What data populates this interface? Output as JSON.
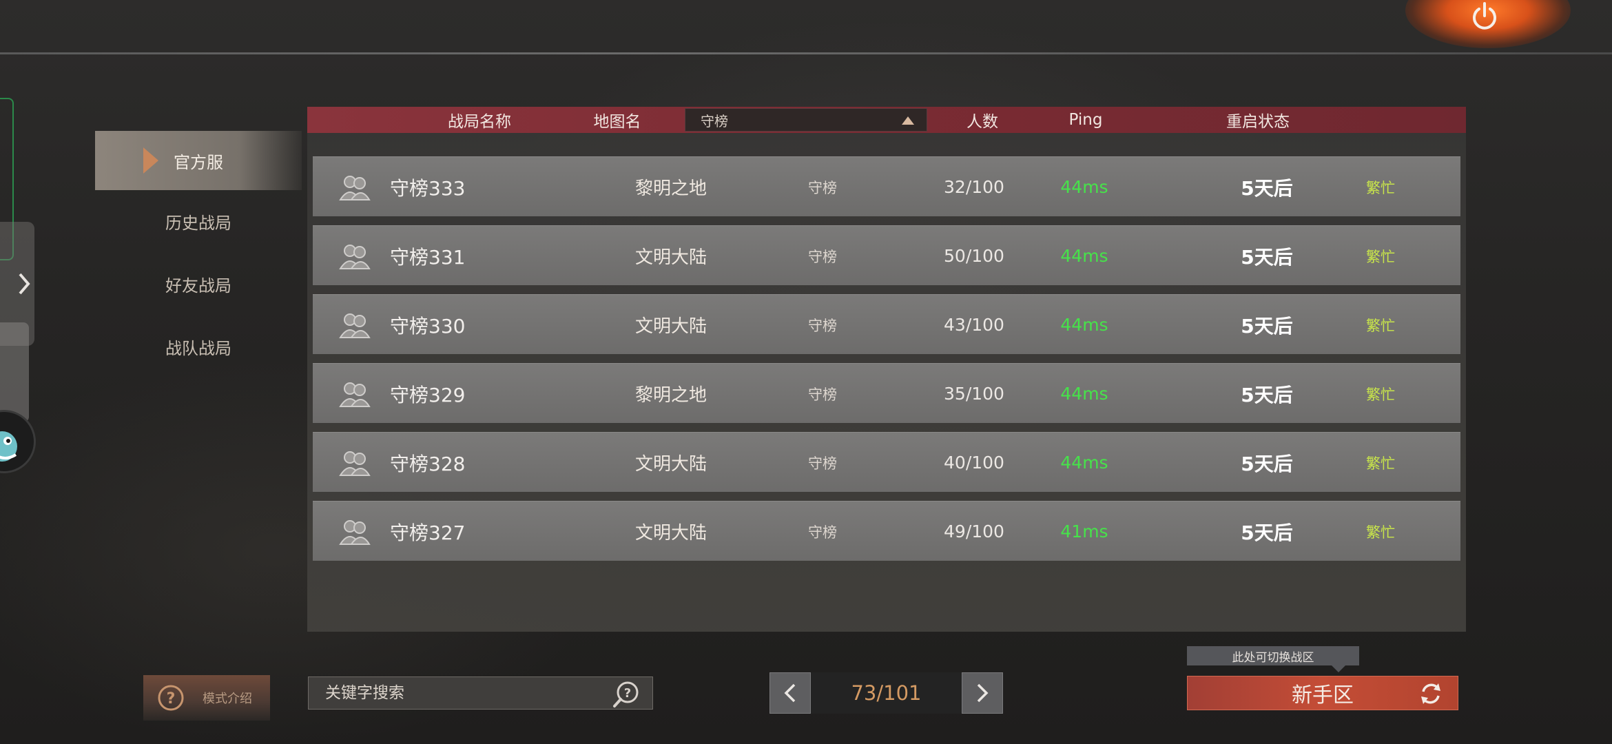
{
  "app": {
    "accent": "#c44d36",
    "header_red": "#8a343c",
    "ping_color": "#46e34a",
    "status_color": "#c9e64a"
  },
  "sidebar": {
    "items": [
      {
        "label": "官方服",
        "active": true
      },
      {
        "label": "历史战局"
      },
      {
        "label": "好友战局"
      },
      {
        "label": "战队战局"
      }
    ]
  },
  "table": {
    "headers": {
      "name": "战局名称",
      "map": "地图名",
      "players": "人数",
      "ping": "Ping",
      "reset": "重启状态"
    },
    "filter": {
      "selected": "守榜"
    },
    "rows": [
      {
        "name": "守榜333",
        "map": "黎明之地",
        "mode": "守榜",
        "players": "32/100",
        "ping": "44ms",
        "reset": "5天后",
        "status": "繁忙"
      },
      {
        "name": "守榜331",
        "map": "文明大陆",
        "mode": "守榜",
        "players": "50/100",
        "ping": "44ms",
        "reset": "5天后",
        "status": "繁忙"
      },
      {
        "name": "守榜330",
        "map": "文明大陆",
        "mode": "守榜",
        "players": "43/100",
        "ping": "44ms",
        "reset": "5天后",
        "status": "繁忙"
      },
      {
        "name": "守榜329",
        "map": "黎明之地",
        "mode": "守榜",
        "players": "35/100",
        "ping": "44ms",
        "reset": "5天后",
        "status": "繁忙"
      },
      {
        "name": "守榜328",
        "map": "文明大陆",
        "mode": "守榜",
        "players": "40/100",
        "ping": "44ms",
        "reset": "5天后",
        "status": "繁忙"
      },
      {
        "name": "守榜327",
        "map": "文明大陆",
        "mode": "守榜",
        "players": "49/100",
        "ping": "41ms",
        "reset": "5天后",
        "status": "繁忙"
      }
    ]
  },
  "bottom": {
    "help_label": "模式介绍",
    "search_placeholder": "关键字搜索",
    "page_text": "73/101",
    "zone_tip": "此处可切换战区",
    "zone_label": "新手区"
  }
}
